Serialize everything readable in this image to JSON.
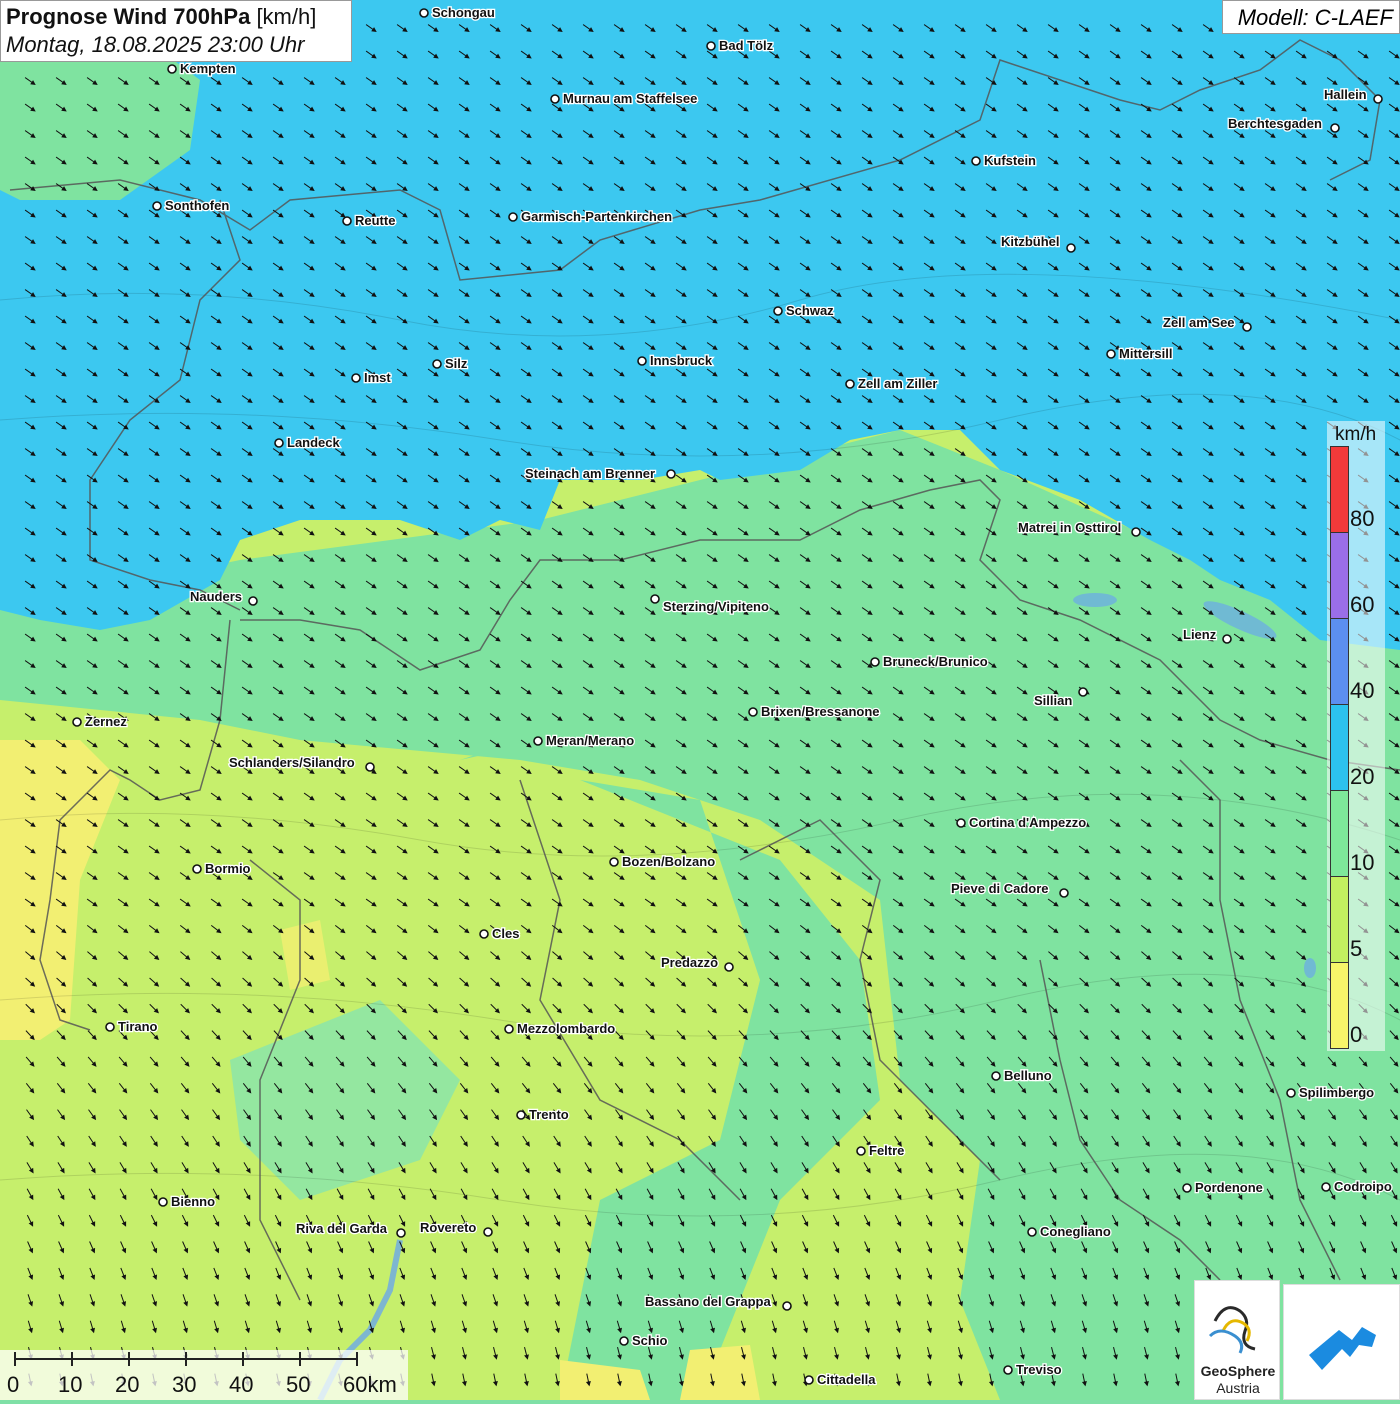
{
  "title": {
    "bold": "Prognose Wind 700hPa",
    "unit": "[km/h]",
    "datetime": "Montag, 18.08.2025 23:00 Uhr"
  },
  "model": "Modell: C-LAEF",
  "legend": {
    "unit": "km/h",
    "labels": [
      "80",
      "60",
      "40",
      "20",
      "10",
      "5",
      "0"
    ],
    "segments": [
      {
        "color": "#f23a3a"
      },
      {
        "color": "#9a6ee8"
      },
      {
        "color": "#5c8ff0"
      },
      {
        "color": "#2cc2ee"
      },
      {
        "color": "#7ee89a"
      },
      {
        "color": "#c2f060"
      },
      {
        "color": "#f7f56a"
      }
    ]
  },
  "scale": {
    "labels": [
      "0",
      "10",
      "20",
      "30",
      "40",
      "50",
      "60km"
    ]
  },
  "colors": {
    "band_20_40": "#3cc8f0",
    "band_10_20": "#7fe3a0",
    "band_5_10": "#c6ef6c",
    "band_0_5": "#f2ef72"
  },
  "wind_direction": "north-west flow, arrows pointing south-east",
  "cities": [
    "Schongau",
    "Bad Tölz",
    "Kempten",
    "Murnau am Staffelsee",
    "Hallein",
    "Berchtesgaden",
    "Kufstein",
    "Sonthofen",
    "Reutte",
    "Garmisch-Partenkirchen",
    "Kitzbühel",
    "Schwaz",
    "Zell am See",
    "Mittersill",
    "Innsbruck",
    "Silz",
    "Imst",
    "Zell am Ziller",
    "Landeck",
    "Steinach am Brenner",
    "Matrei in Osttirol",
    "Nauders",
    "Sterzing/Vipiteno",
    "Lienz",
    "Bruneck/Brunico",
    "Sillian",
    "Zernez",
    "Brixen/Bressanone",
    "Meran/Merano",
    "Schlanders/Silandro",
    "Cortina d'Ampezzo",
    "Bozen/Bolzano",
    "Bormio",
    "Pieve di Cadore",
    "Cles",
    "Predazzo",
    "Tirano",
    "Mezzolombardo",
    "Belluno",
    "Spilimbergo",
    "Trento",
    "Feltre",
    "Bienno",
    "Pordenone",
    "Codroipo",
    "Riva del Garda",
    "Rovereto",
    "Conegliano",
    "Bassano del Grappa",
    "Schio",
    "Treviso",
    "Cittadella"
  ],
  "logo": {
    "line1": "GeoSphere",
    "line2": "Austria"
  }
}
